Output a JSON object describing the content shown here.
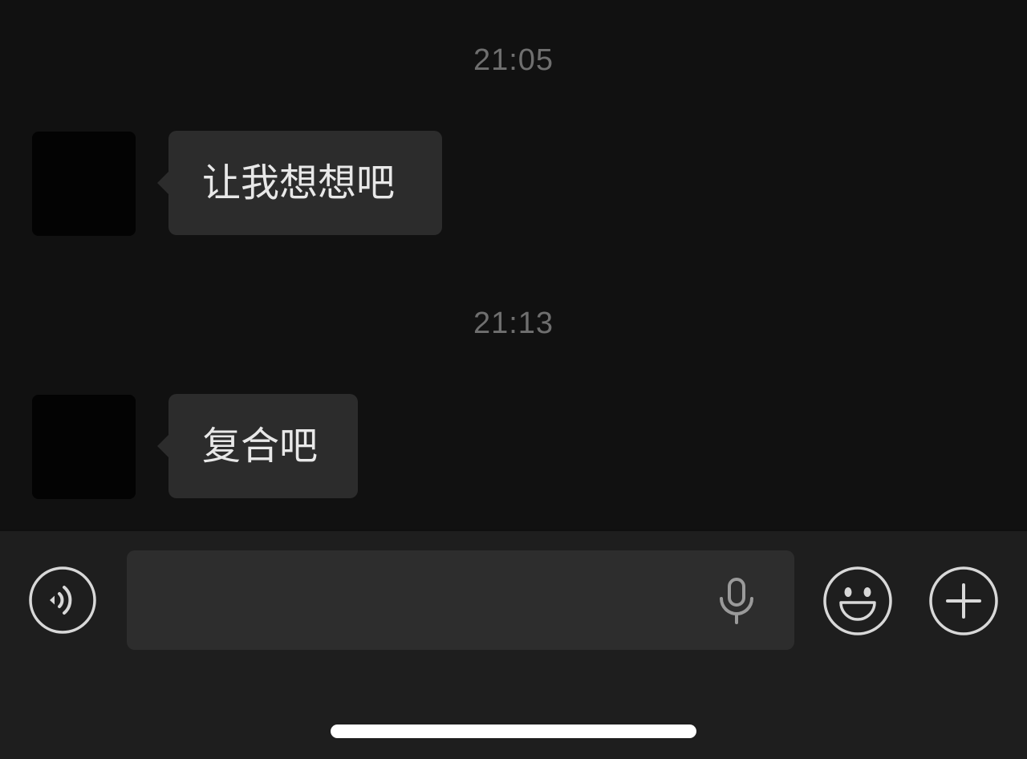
{
  "messages": [
    {
      "timestamp": "21:05",
      "text": "让我想想吧"
    },
    {
      "timestamp": "21:13",
      "text": "复合吧"
    }
  ],
  "input_bar": {
    "text_value": "",
    "icons": {
      "voice": "voice-icon",
      "mic": "mic-icon",
      "emoji": "emoji-icon",
      "plus": "plus-icon"
    }
  },
  "colors": {
    "background": "#111111",
    "bubble": "#2c2c2c",
    "bubble_text": "#e8e8e8",
    "timestamp": "#6f6f6f",
    "input_bar": "#1e1e1e",
    "input_field": "#2d2d2d",
    "icon": "#d8d8d8"
  }
}
